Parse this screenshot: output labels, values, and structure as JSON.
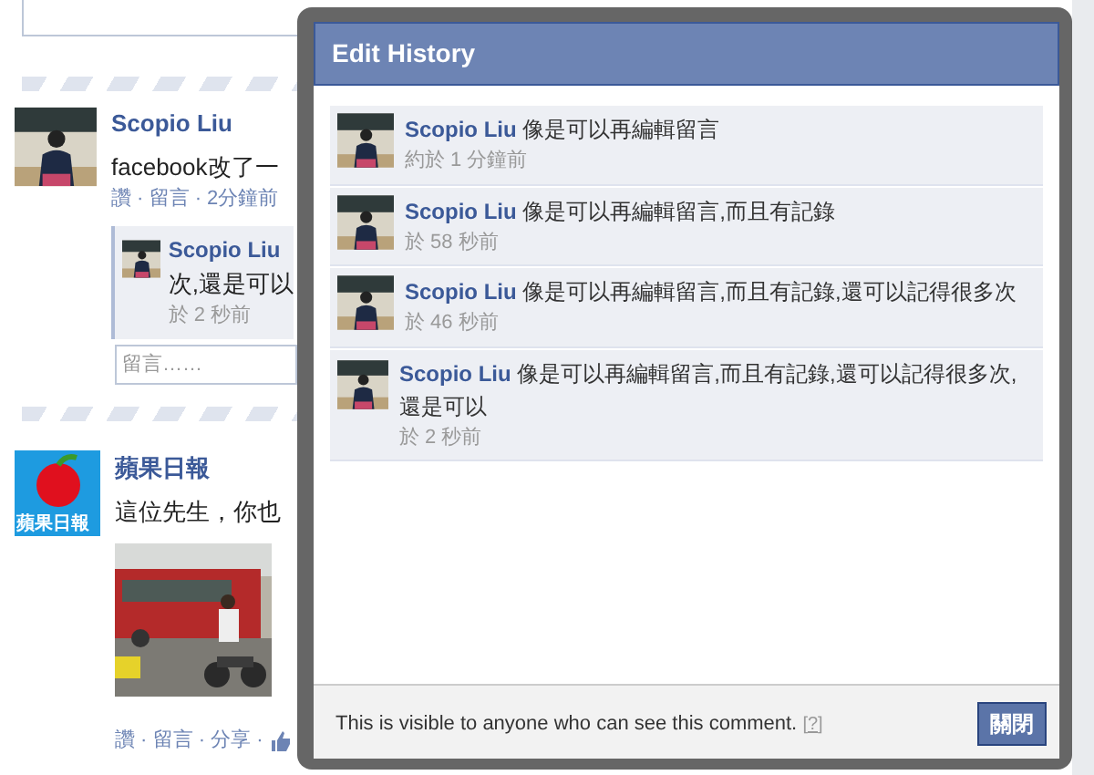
{
  "feed": {
    "status_post": {
      "author": "Scopio Liu",
      "text": "facebook改了一",
      "actions_line": "讚 · 留言 · 2分鐘前",
      "comment": {
        "author": "Scopio Liu",
        "text": "次,還是可以",
        "time": "於 2 秒前"
      },
      "comment_field": {
        "placeholder": "留言……"
      }
    },
    "link_post": {
      "author": "蘋果日報",
      "logo_text": "蘋果日報",
      "text": "這位先生，你也",
      "actions_line": "讚 · 留言 · 分享 ·"
    }
  },
  "dialog": {
    "title": "Edit History",
    "entries": [
      {
        "author": "Scopio Liu",
        "text": "像是可以再編輯留言",
        "time": "約於 1 分鐘前"
      },
      {
        "author": "Scopio Liu",
        "text": "像是可以再編輯留言,而且有記錄",
        "time": "於 58 秒前"
      },
      {
        "author": "Scopio Liu",
        "text": "像是可以再編輯留言,而且有記錄,還可以記得很多次",
        "time": "於 46 秒前"
      },
      {
        "author": "Scopio Liu",
        "text": "像是可以再編輯留言,而且有記錄,還可以記得很多次,還是可以",
        "time": "於 2 秒前"
      }
    ],
    "footer_note": "This is visible to anyone who can see this comment.",
    "help_link": "[?]",
    "close_button": "關閉"
  }
}
